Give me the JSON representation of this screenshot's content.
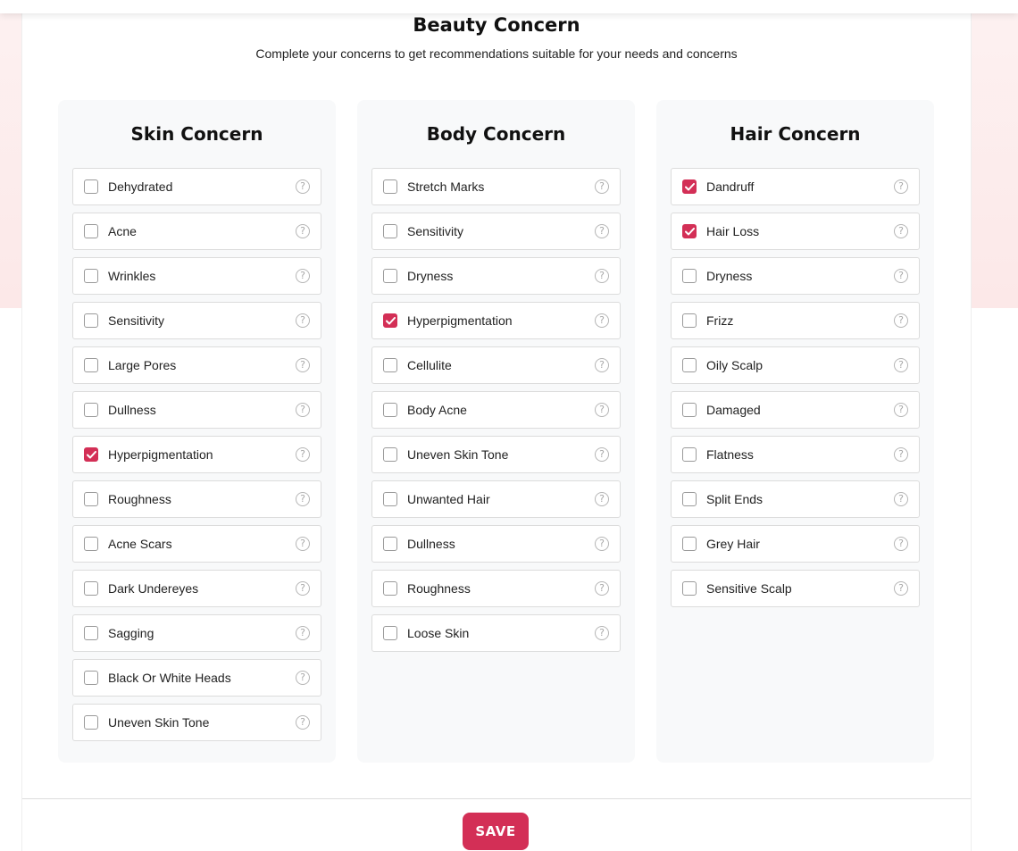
{
  "page": {
    "title": "Beauty Concern",
    "subtitle": "Complete your concerns to get recommendations suitable for your needs and concerns"
  },
  "colors": {
    "accent": "#d32f56",
    "column_background": "#f8f9fa",
    "page_tint": "#fce8e8"
  },
  "columns": [
    {
      "title": "Skin Concern",
      "items": [
        {
          "label": "Dehydrated",
          "checked": false
        },
        {
          "label": "Acne",
          "checked": false
        },
        {
          "label": "Wrinkles",
          "checked": false
        },
        {
          "label": "Sensitivity",
          "checked": false
        },
        {
          "label": "Large Pores",
          "checked": false
        },
        {
          "label": "Dullness",
          "checked": false
        },
        {
          "label": "Hyperpigmentation",
          "checked": true
        },
        {
          "label": "Roughness",
          "checked": false
        },
        {
          "label": "Acne Scars",
          "checked": false
        },
        {
          "label": "Dark Undereyes",
          "checked": false
        },
        {
          "label": "Sagging",
          "checked": false
        },
        {
          "label": "Black Or White Heads",
          "checked": false
        },
        {
          "label": "Uneven Skin Tone",
          "checked": false
        }
      ]
    },
    {
      "title": "Body Concern",
      "items": [
        {
          "label": "Stretch Marks",
          "checked": false
        },
        {
          "label": "Sensitivity",
          "checked": false
        },
        {
          "label": "Dryness",
          "checked": false
        },
        {
          "label": "Hyperpigmentation",
          "checked": true
        },
        {
          "label": "Cellulite",
          "checked": false
        },
        {
          "label": "Body Acne",
          "checked": false
        },
        {
          "label": "Uneven Skin Tone",
          "checked": false
        },
        {
          "label": "Unwanted Hair",
          "checked": false
        },
        {
          "label": "Dullness",
          "checked": false
        },
        {
          "label": "Roughness",
          "checked": false
        },
        {
          "label": "Loose Skin",
          "checked": false
        }
      ]
    },
    {
      "title": "Hair Concern",
      "items": [
        {
          "label": "Dandruff",
          "checked": true
        },
        {
          "label": "Hair Loss",
          "checked": true
        },
        {
          "label": "Dryness",
          "checked": false
        },
        {
          "label": "Frizz",
          "checked": false
        },
        {
          "label": "Oily Scalp",
          "checked": false
        },
        {
          "label": "Damaged",
          "checked": false
        },
        {
          "label": "Flatness",
          "checked": false
        },
        {
          "label": "Split Ends",
          "checked": false
        },
        {
          "label": "Grey Hair",
          "checked": false
        },
        {
          "label": "Sensitive Scalp",
          "checked": false
        }
      ]
    }
  ],
  "help_icon_glyph": "?",
  "icons": {
    "help": "question-circle-icon",
    "check": "checkmark-icon"
  },
  "footer": {
    "save_label": "SAVE"
  }
}
